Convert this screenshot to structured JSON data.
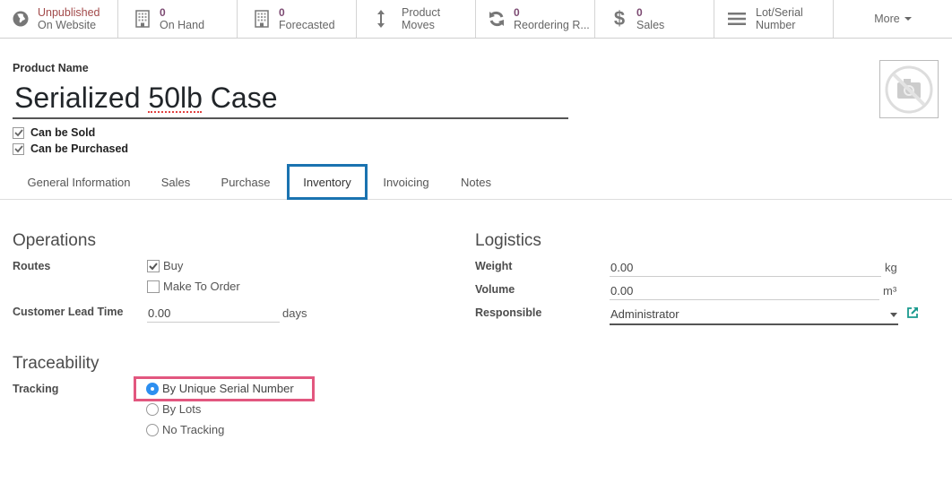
{
  "smart_buttons": [
    {
      "id": "website",
      "icon": "globe-icon",
      "value": "Unpublished",
      "label": "On Website"
    },
    {
      "id": "on-hand",
      "icon": "building-icon",
      "value": "0",
      "label": "On Hand"
    },
    {
      "id": "forecasted",
      "icon": "building-icon",
      "value": "0",
      "label": "Forecasted"
    },
    {
      "id": "product-moves",
      "icon": "arrows-vertical-icon",
      "label": "Product Moves"
    },
    {
      "id": "reordering",
      "icon": "refresh-icon",
      "value": "0",
      "label": "Reordering R..."
    },
    {
      "id": "sales",
      "icon": "dollar-icon",
      "value": "0",
      "label": "Sales"
    },
    {
      "id": "lot-serial",
      "icon": "list-icon",
      "label_line1": "Lot/Serial",
      "label_line2": "Number"
    },
    {
      "id": "more",
      "label": "More"
    }
  ],
  "product": {
    "name_label": "Product Name",
    "name": "Serialized 50lb Case",
    "can_be_sold_label": "Can be Sold",
    "can_be_sold": true,
    "can_be_purchased_label": "Can be Purchased",
    "can_be_purchased": true,
    "image_placeholder": "no-image-camera-icon"
  },
  "tabs": [
    {
      "label": "General Information",
      "active": false
    },
    {
      "label": "Sales",
      "active": false
    },
    {
      "label": "Purchase",
      "active": false
    },
    {
      "label": "Inventory",
      "active": true
    },
    {
      "label": "Invoicing",
      "active": false
    },
    {
      "label": "Notes",
      "active": false
    }
  ],
  "operations": {
    "title": "Operations",
    "routes_label": "Routes",
    "routes": [
      {
        "label": "Buy",
        "checked": true
      },
      {
        "label": "Make To Order",
        "checked": false
      }
    ],
    "lead_time_label": "Customer Lead Time",
    "lead_time_value": "0.00",
    "lead_time_unit": "days"
  },
  "logistics": {
    "title": "Logistics",
    "weight_label": "Weight",
    "weight_value": "0.00",
    "weight_unit": "kg",
    "volume_label": "Volume",
    "volume_value": "0.00",
    "volume_unit": "m³",
    "responsible_label": "Responsible",
    "responsible_value": "Administrator"
  },
  "traceability": {
    "title": "Traceability",
    "tracking_label": "Tracking",
    "options": [
      {
        "label": "By Unique Serial Number",
        "selected": true
      },
      {
        "label": "By Lots",
        "selected": false
      },
      {
        "label": "No Tracking",
        "selected": false
      }
    ]
  },
  "colors": {
    "active_tab_border": "#1a73b0",
    "highlight_border": "#e2577f",
    "radio_selected": "#2d8ff0",
    "unpublished_text": "#a24a4a",
    "stat_value": "#7c4a72",
    "external_link": "#1a9a8e"
  }
}
